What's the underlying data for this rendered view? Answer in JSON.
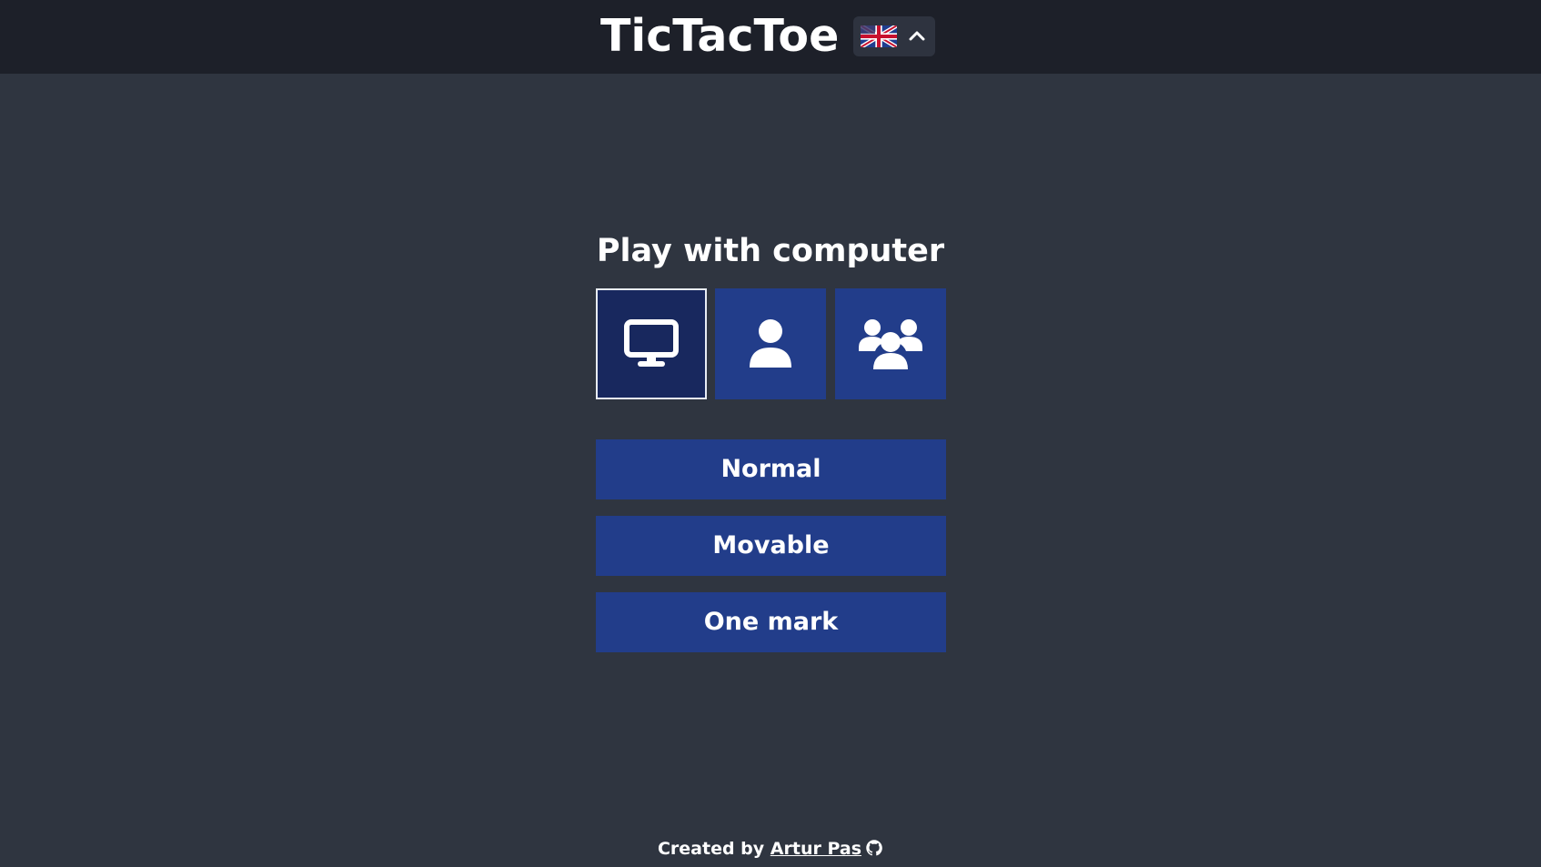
{
  "header": {
    "title": "TicTacToe",
    "language_icon": "uk-flag-icon",
    "language_toggle_icon": "chevron-up-icon"
  },
  "main": {
    "mode_title": "Play with computer",
    "modes": [
      {
        "icon": "computer-icon",
        "selected": true
      },
      {
        "icon": "user-icon",
        "selected": false
      },
      {
        "icon": "users-group-icon",
        "selected": false
      }
    ],
    "variants": [
      "Normal",
      "Movable",
      "One mark"
    ]
  },
  "footer": {
    "created_by": "Created by",
    "author": "Artur Pas",
    "author_icon": "github-icon"
  },
  "colors": {
    "background": "#2f3540",
    "header": "#1d2029",
    "accent": "#223d8a",
    "accent_selected": "#18285e"
  }
}
